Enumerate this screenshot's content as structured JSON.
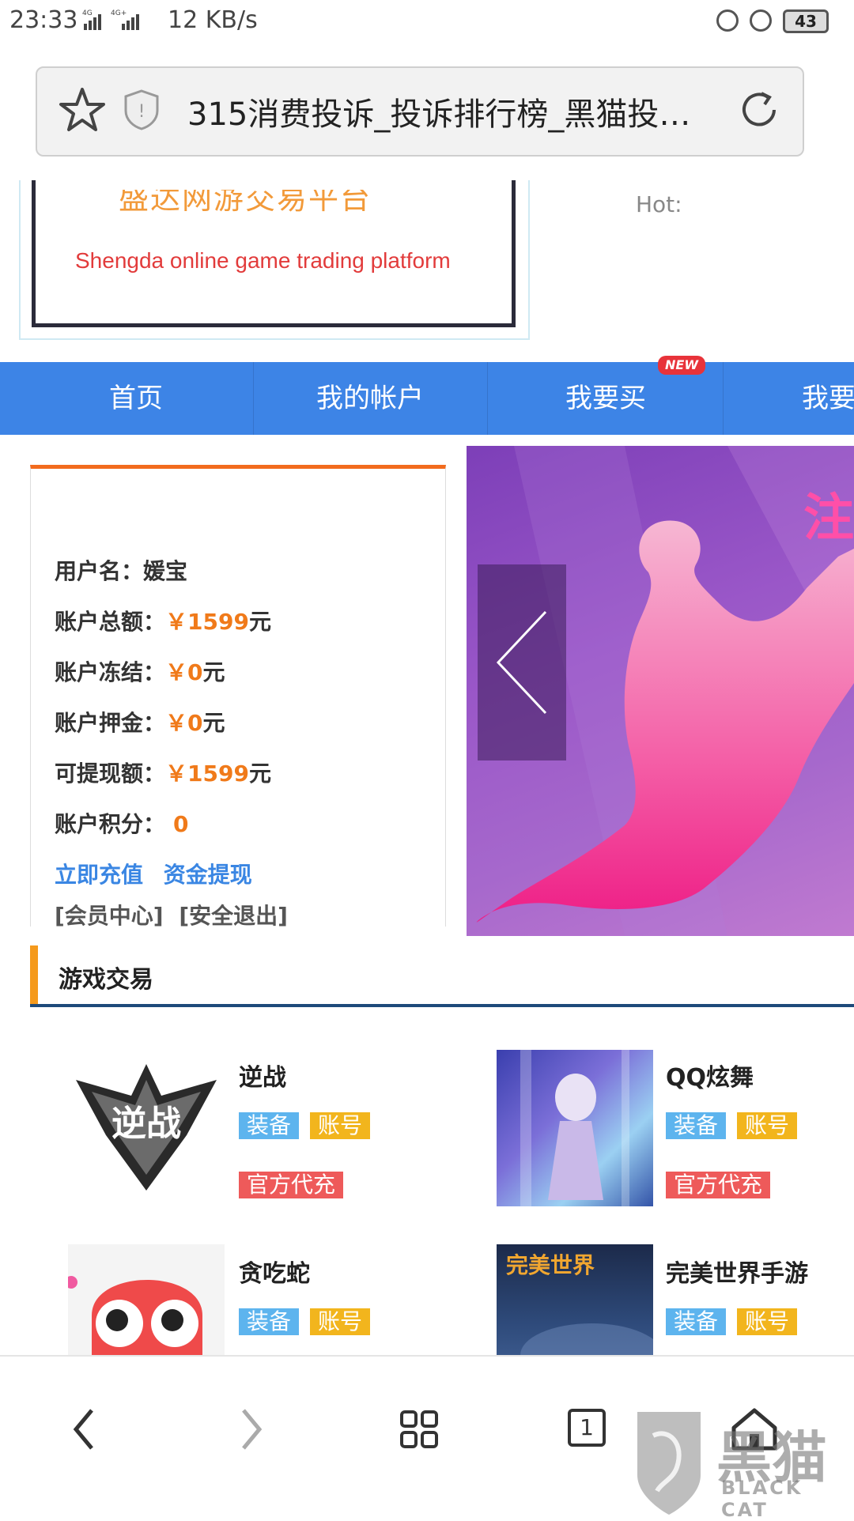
{
  "status_bar": {
    "time": "23:33",
    "network": "4G 4G+",
    "speed": "12 KB/s",
    "battery": "43"
  },
  "browser": {
    "page_title": "315消费投诉_投诉排行榜_黑猫投…"
  },
  "banner": {
    "title_cn": "盛达网游交易平台",
    "title_en": "Shengda online game trading platform",
    "hot_label": "Hot:"
  },
  "nav": {
    "items": [
      "首页",
      "我的帐户",
      "我要买",
      "我要卖"
    ],
    "new_badge": "NEW"
  },
  "account": {
    "username_label": "用户名：",
    "username": "媛宝",
    "total_label": "账户总额：",
    "total_value": "￥1599",
    "frozen_label": "账户冻结：",
    "frozen_value": "￥0",
    "deposit_label": "账户押金：",
    "deposit_value": "￥0",
    "withdrawable_label": "可提现额：",
    "withdrawable_value": "￥1599",
    "points_label": "账户积分：",
    "points_value": "0",
    "unit": "元",
    "recharge_link": "立即充值",
    "withdraw_link": "资金提现",
    "member_center_link": "[会员中心]",
    "logout_link": "[安全退出]"
  },
  "ad": {
    "text_fragment": "注"
  },
  "games_section": {
    "title": "游戏交易",
    "games": [
      {
        "name": "逆战",
        "tags": [
          "装备",
          "账号",
          "官方代充"
        ],
        "logo_text": "逆战"
      },
      {
        "name": "QQ炫舞",
        "tags": [
          "装备",
          "账号",
          "官方代充"
        ]
      },
      {
        "name": "贪吃蛇",
        "tags": [
          "装备",
          "账号"
        ]
      },
      {
        "name": "完美世界手游",
        "tags": [
          "装备",
          "账号"
        ],
        "logo_text": "完美世界"
      }
    ]
  },
  "toolbar": {
    "tab_count": "1"
  },
  "watermark": {
    "cn": "黑猫",
    "en": "BLACK CAT"
  },
  "colors": {
    "nav_blue": "#3d84e6",
    "accent_orange": "#f07a1a",
    "tag_blue": "#5db4ee",
    "tag_yellow": "#f2b51d",
    "tag_red": "#ee5a5a"
  }
}
